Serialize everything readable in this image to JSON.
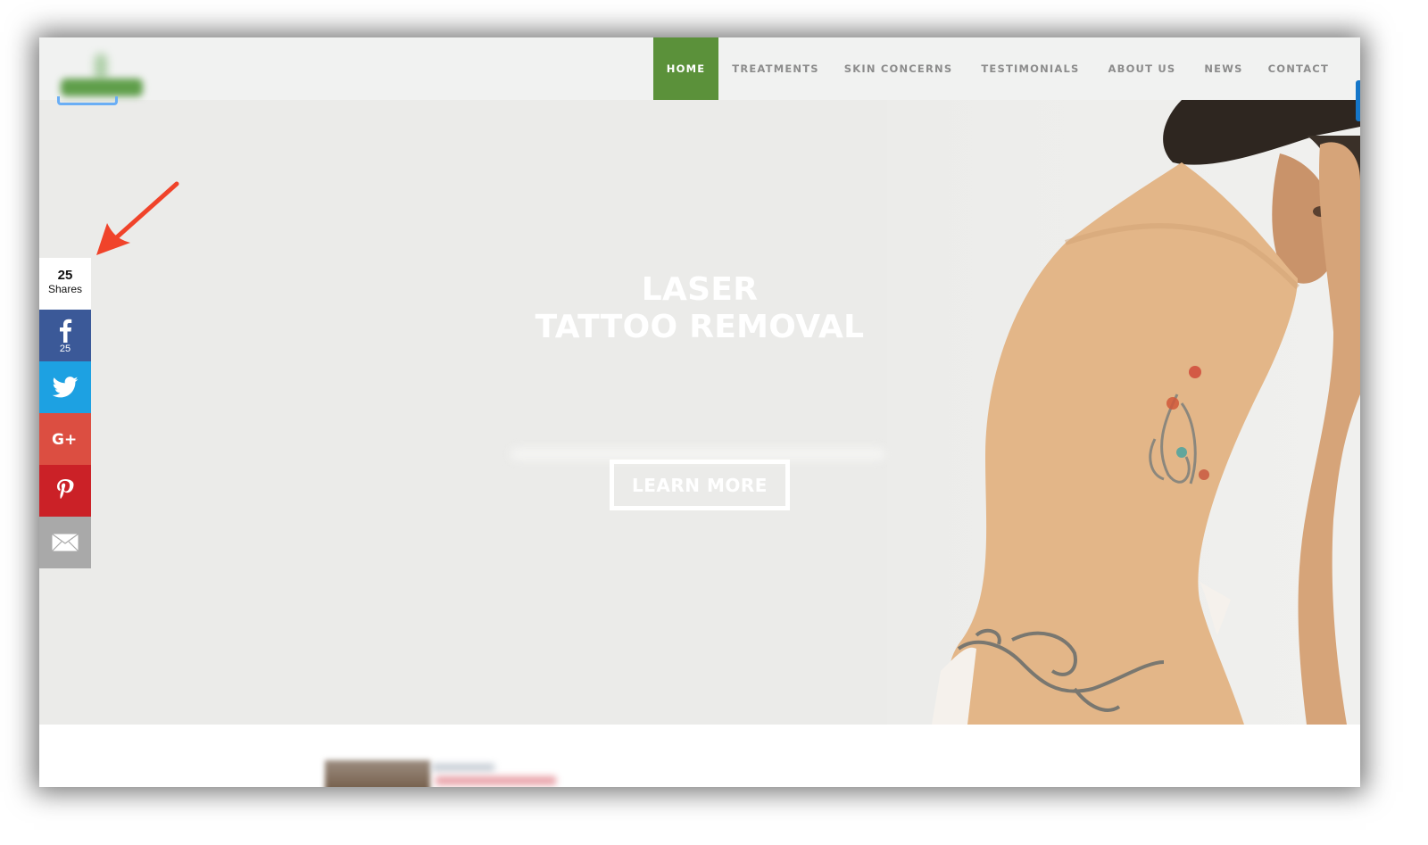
{
  "header": {
    "logo_alt": "site-logo (blurred)",
    "nav": [
      {
        "label": "HOME",
        "active": true
      },
      {
        "label": "TREATMENTS",
        "active": false
      },
      {
        "label": "SKIN CONCERNS",
        "active": false
      },
      {
        "label": "TESTIMONIALS",
        "active": false
      },
      {
        "label": "ABOUT US",
        "active": false
      },
      {
        "label": "NEWS",
        "active": false
      },
      {
        "label": "CONTACT",
        "active": false
      }
    ]
  },
  "hero": {
    "title_line1": "LASER",
    "title_line2": "TATTOO REMOVAL",
    "subtitle_blurred": true,
    "cta_label": "LEARN MORE",
    "image": "woman-back-with-tattoos-photo"
  },
  "share_bar": {
    "total_count": "25",
    "total_label": "Shares",
    "buttons": [
      {
        "network": "facebook",
        "icon": "facebook-icon",
        "count": "25",
        "color": "#3b5998"
      },
      {
        "network": "twitter",
        "icon": "twitter-icon",
        "count": "",
        "color": "#1da1e2"
      },
      {
        "network": "google-plus",
        "icon": "google-plus-icon",
        "count": "",
        "color": "#dc4e41"
      },
      {
        "network": "pinterest",
        "icon": "pinterest-icon",
        "count": "",
        "color": "#cb2127"
      },
      {
        "network": "email",
        "icon": "email-icon",
        "count": "",
        "color": "#a9a9a9"
      }
    ]
  },
  "annotation": {
    "arrow_color": "#f0432a",
    "points_to": "share-bar"
  },
  "colors": {
    "nav_active_bg": "#5b913a",
    "nav_text": "#8c8c8c",
    "header_bg": "#f1f2f1",
    "hero_bg": "#ebebe9"
  }
}
